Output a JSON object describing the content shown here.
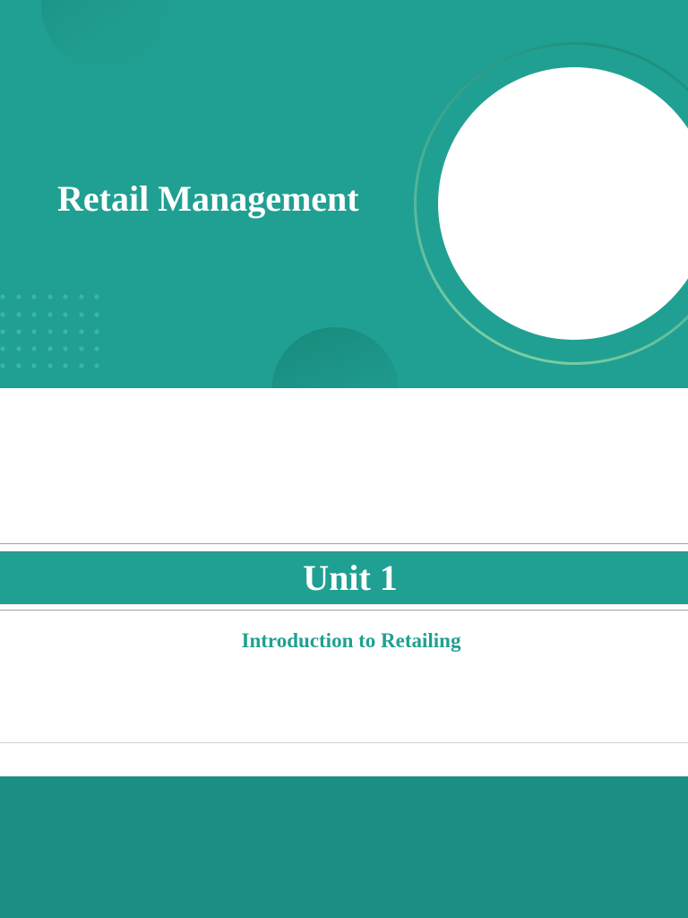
{
  "title_slide": {
    "title": "Retail Management"
  },
  "unit_slide": {
    "unit_label": "Unit 1",
    "subtitle": "Introduction to Retailing"
  },
  "colors": {
    "teal": "#20a092",
    "teal_dark": "#1b8f84",
    "white": "#ffffff"
  }
}
